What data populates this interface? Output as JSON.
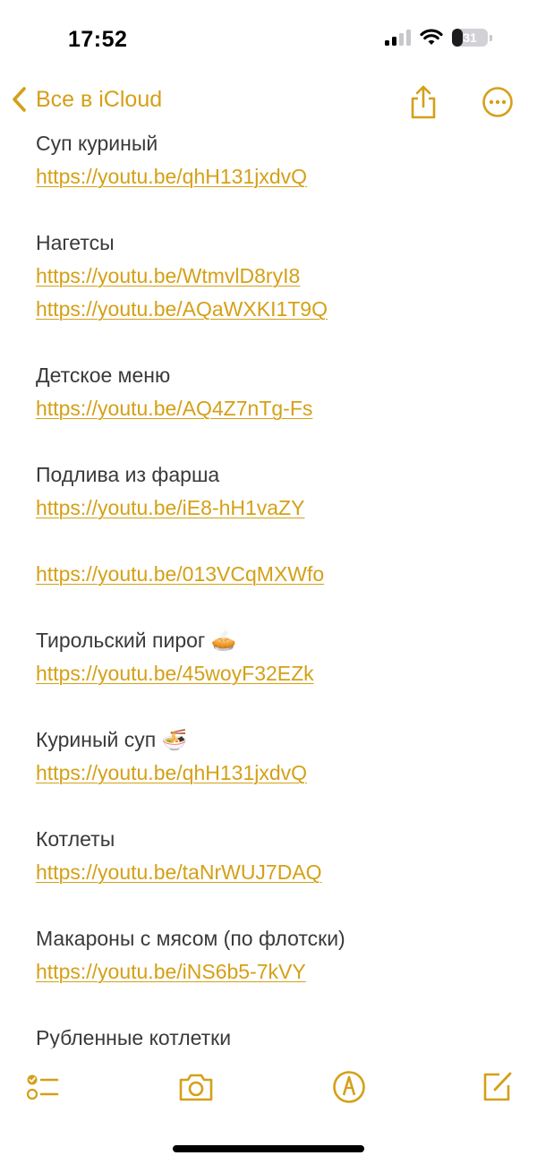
{
  "status_bar": {
    "time": "17:52",
    "battery_level": "31",
    "battery_percent": 31,
    "icons": [
      "cellular-signal-icon",
      "wifi-icon",
      "battery-icon"
    ]
  },
  "nav": {
    "back_label": "Все в iCloud",
    "icons": [
      "chevron-left-icon",
      "share-icon",
      "more-icon"
    ]
  },
  "note": {
    "lines": [
      {
        "type": "text",
        "text": "Суп куриный"
      },
      {
        "type": "link",
        "text": "https://youtu.be/qhH131jxdvQ"
      },
      {
        "type": "blank"
      },
      {
        "type": "text",
        "text": "Нагетсы"
      },
      {
        "type": "link",
        "text": "https://youtu.be/WtmvlD8ryI8"
      },
      {
        "type": "link",
        "text": "https://youtu.be/AQaWXKI1T9Q"
      },
      {
        "type": "blank"
      },
      {
        "type": "text",
        "text": "Детское меню"
      },
      {
        "type": "link",
        "text": "https://youtu.be/AQ4Z7nTg-Fs"
      },
      {
        "type": "blank"
      },
      {
        "type": "text",
        "text": "Подлива из фарша"
      },
      {
        "type": "link",
        "text": "https://youtu.be/iE8-hH1vaZY"
      },
      {
        "type": "blank"
      },
      {
        "type": "link",
        "text": "https://youtu.be/013VCqMXWfo"
      },
      {
        "type": "blank"
      },
      {
        "type": "text",
        "text": "Тирольский пирог 🥧"
      },
      {
        "type": "link",
        "text": "https://youtu.be/45woyF32EZk"
      },
      {
        "type": "blank"
      },
      {
        "type": "text",
        "text": "Куриный суп 🍜"
      },
      {
        "type": "link",
        "text": "https://youtu.be/qhH131jxdvQ"
      },
      {
        "type": "blank"
      },
      {
        "type": "text",
        "text": "Котлеты"
      },
      {
        "type": "link",
        "text": "https://youtu.be/taNrWUJ7DAQ"
      },
      {
        "type": "blank"
      },
      {
        "type": "text",
        "text": "Макароны с мясом (по флотски)"
      },
      {
        "type": "link",
        "text": "https://youtu.be/iNS6b5-7kVY"
      },
      {
        "type": "blank"
      },
      {
        "type": "text",
        "text": "Рубленные котлетки"
      }
    ]
  },
  "toolbar": {
    "icons": [
      "checklist-icon",
      "camera-icon",
      "markup-icon",
      "compose-icon"
    ]
  },
  "colors": {
    "accent": "#d4a017",
    "text": "#3a3a3c",
    "background": "#ffffff"
  }
}
